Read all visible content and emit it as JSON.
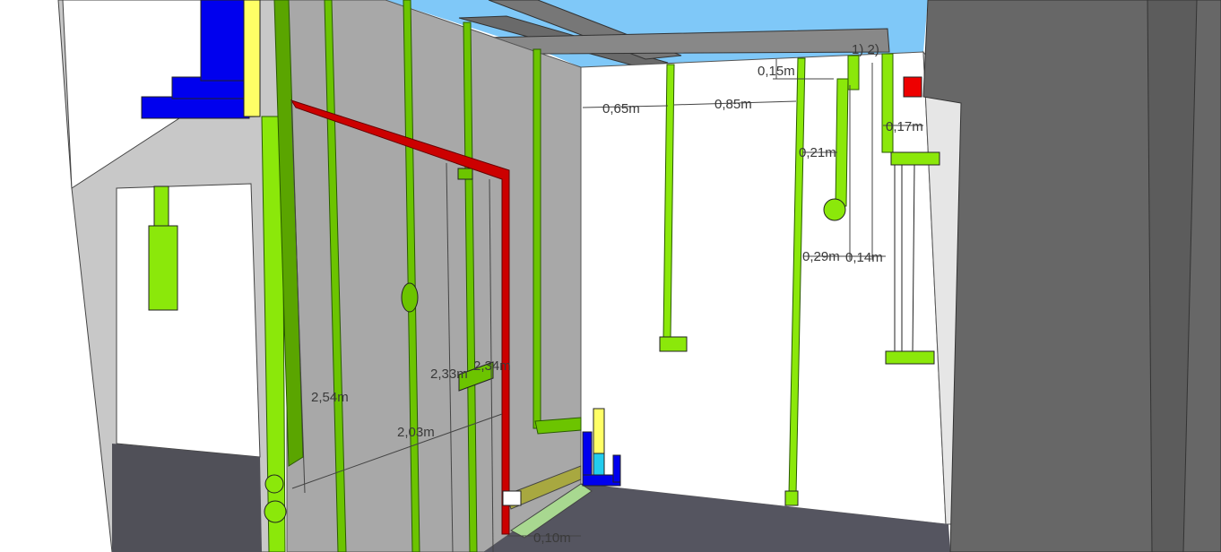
{
  "dimensions": {
    "d_065": "0,65m",
    "d_085": "0,85m",
    "d_015": "0,15m",
    "d_017": "0,17m",
    "d_021": "0,21m",
    "d_029": "0,29m",
    "d_014": "0,14m",
    "d_254": "2,54m",
    "d_233": "2,33m",
    "d_234": "2,34m",
    "d_203": "2,03m",
    "d_010": "0,10m",
    "top_labels": "1) 2)"
  },
  "colors": {
    "sky": "#7fc8f8",
    "wall_grey": "#a8a8a8",
    "wall_white": "#ffffff",
    "dark_wall": "#676767",
    "floor": "#555560",
    "pipe_green": "#8be80a",
    "pipe_green_dark": "#52a000",
    "hot_pipe": "#cc0000",
    "blue": "#0000ee",
    "yellow": "#ffff66",
    "cyan": "#22ccee"
  }
}
